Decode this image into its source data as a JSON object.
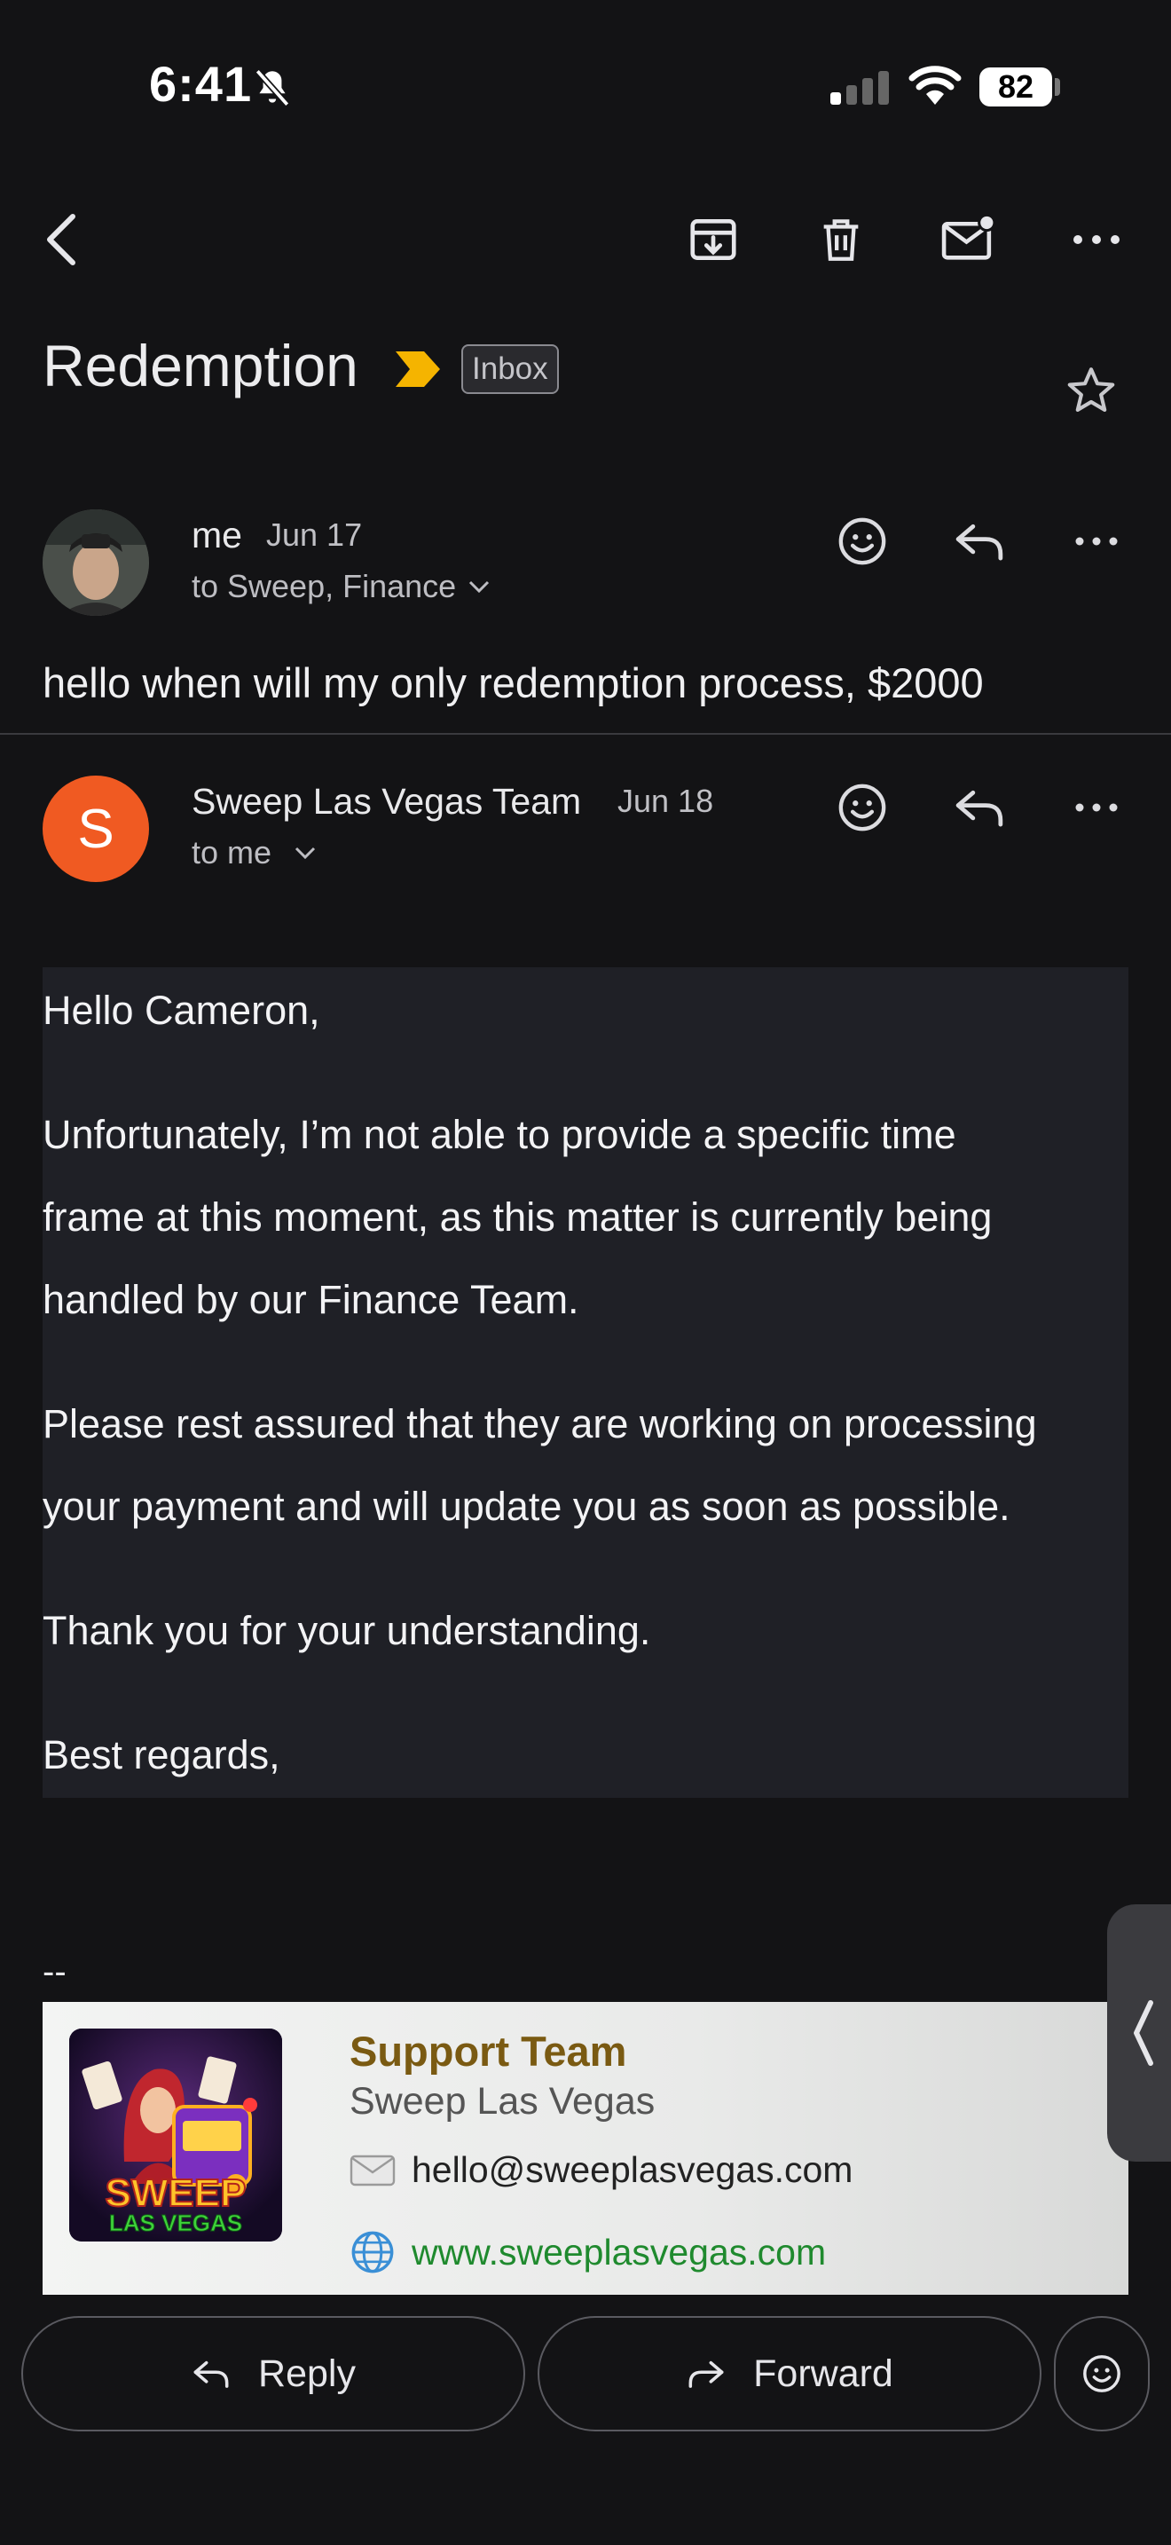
{
  "status_bar": {
    "time": "6:41",
    "battery": "82"
  },
  "subject": {
    "title": "Redemption",
    "label_chip": "Inbox"
  },
  "message1": {
    "sender": "me",
    "date": "Jun 17",
    "recipients": "to Sweep, Finance",
    "snippet": "hello when will my only redemption process, $2000"
  },
  "message2": {
    "sender": "Sweep Las Vegas Team",
    "date": "Jun 18",
    "avatar_letter": "S",
    "recipients": "to me",
    "body": {
      "greeting": "Hello Cameron,",
      "p1_line1": "Unfortunately, I’m not able to provide a specific time",
      "p1_line2": "frame at this moment, as this matter is currently being",
      "p1_line3": "handled by our Finance Team.",
      "p2_line1": "Please rest assured that they are working on processing",
      "p2_line2": "your payment and will update you as soon as possible.",
      "p3": "Thank you for your understanding.",
      "closing": "Best regards,"
    },
    "signature": {
      "dash": "--",
      "name": "Support Team",
      "company": "Sweep Las Vegas",
      "email": "hello@sweeplasvegas.com",
      "website": "www.sweeplasvegas.com",
      "logo_text_1": "SWEEP",
      "logo_text_2": "LAS VEGAS"
    }
  },
  "actions": {
    "reply": "Reply",
    "forward": "Forward"
  },
  "colors": {
    "avatar_s": "#f05a22",
    "label_marker": "#f5b400",
    "sig_name": "#7a5a12",
    "sig_link": "#1f8a2e"
  }
}
